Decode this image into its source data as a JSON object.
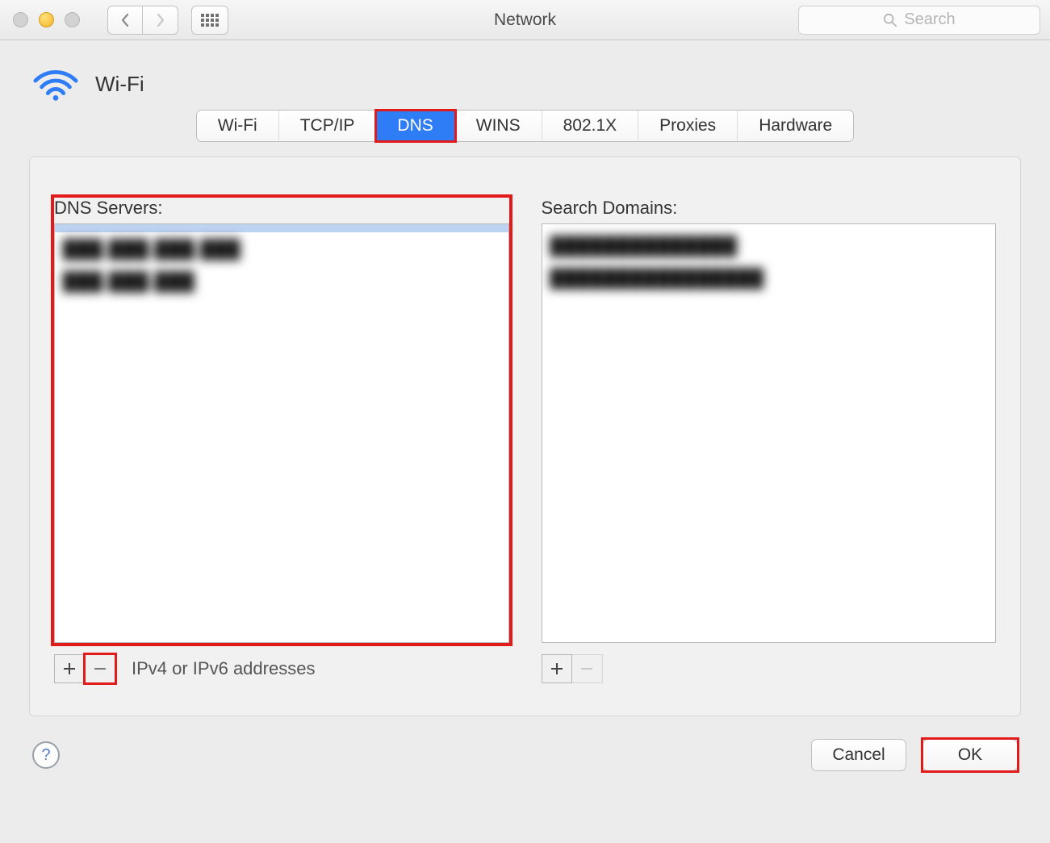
{
  "window": {
    "title": "Network"
  },
  "search": {
    "placeholder": "Search"
  },
  "header": {
    "interface_label": "Wi-Fi"
  },
  "tabs": [
    {
      "label": "Wi-Fi",
      "active": false
    },
    {
      "label": "TCP/IP",
      "active": false
    },
    {
      "label": "DNS",
      "active": true
    },
    {
      "label": "WINS",
      "active": false
    },
    {
      "label": "802.1X",
      "active": false
    },
    {
      "label": "Proxies",
      "active": false
    },
    {
      "label": "Hardware",
      "active": false
    }
  ],
  "dns": {
    "servers_label": "DNS Servers:",
    "servers_hint": "IPv4 or IPv6 addresses",
    "servers": [
      "███.███.███.███",
      "███.███.███"
    ],
    "search_domains_label": "Search Domains:",
    "search_domains": [
      "██████████████",
      "████████████████"
    ]
  },
  "footer": {
    "cancel": "Cancel",
    "ok": "OK"
  }
}
